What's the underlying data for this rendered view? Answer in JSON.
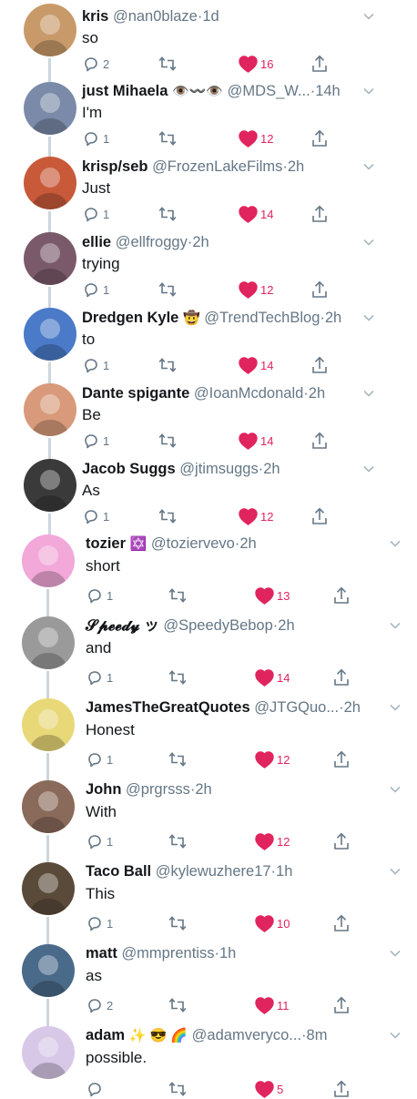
{
  "tweets": [
    {
      "name": "kris",
      "handle": "@nan0blaze",
      "sep": "·",
      "time": "1d",
      "text": "so",
      "replies": "2",
      "likes": "16",
      "avatar_color": "#c89a6a"
    },
    {
      "name": "just Mihaela",
      "badge": "👁️〰️👁️",
      "handle": "@MDS_W...",
      "sep": "·",
      "time": "14h",
      "text": "I'm",
      "replies": "1",
      "likes": "12",
      "avatar_color": "#7a8aa8"
    },
    {
      "name": "krisp/seb",
      "handle": "@FrozenLakeFilms",
      "sep": "·",
      "time": "2h",
      "text": "Just",
      "replies": "1",
      "likes": "14",
      "avatar_color": "#c85a3a"
    },
    {
      "name": "ellie",
      "handle": "@ellfroggy",
      "sep": "·",
      "time": "2h",
      "text": "trying",
      "replies": "1",
      "likes": "12",
      "avatar_color": "#7a5a6a"
    },
    {
      "name": "Dredgen Kyle",
      "badge": "🤠",
      "handle": "@TrendTechBlog",
      "sep": "·",
      "time": "2h",
      "text": "to",
      "replies": "1",
      "likes": "14",
      "avatar_color": "#4a7ac8"
    },
    {
      "name": "Dante spigante",
      "handle": "@IoanMcdonald",
      "sep": "·",
      "time": "2h",
      "text": "Be",
      "replies": "1",
      "likes": "14",
      "avatar_color": "#d89a7a"
    },
    {
      "name": "Jacob Suggs",
      "handle": "@jtimsuggs",
      "sep": "·",
      "time": "2h",
      "text": "As",
      "replies": "1",
      "likes": "12",
      "avatar_color": "#3a3a3a"
    },
    {
      "name": "tozier",
      "badge": "✡️",
      "handle": "@toziervevo",
      "sep": "·",
      "time": "2h",
      "text": "short",
      "replies": "1",
      "likes": "13",
      "avatar_color": "#f2a8d8"
    },
    {
      "name": "𝓢𝓹𝓮𝓮𝓭𝔂 ッ",
      "handle": "@SpeedyBebop",
      "sep": "·",
      "time": "2h",
      "text": "and",
      "replies": "1",
      "likes": "14",
      "avatar_color": "#9a9a9a"
    },
    {
      "name": "JamesTheGreatQuotes",
      "handle": "@JTGQuo...",
      "sep": "·",
      "time": "2h",
      "text": "Honest",
      "replies": "1",
      "likes": "12",
      "avatar_color": "#e8d878"
    },
    {
      "name": "John",
      "handle": "@prgrsss",
      "sep": "·",
      "time": "2h",
      "text": "With",
      "replies": "1",
      "likes": "12",
      "avatar_color": "#8a6a5a"
    },
    {
      "name": "Taco Ball",
      "handle": "@kylewuzhere17",
      "sep": "·",
      "time": "1h",
      "text": "This",
      "replies": "1",
      "likes": "10",
      "avatar_color": "#5a4a3a"
    },
    {
      "name": "matt",
      "handle": "@mmprentiss",
      "sep": "·",
      "time": "1h",
      "text": "as",
      "replies": "2",
      "likes": "11",
      "avatar_color": "#4a6a8a"
    },
    {
      "name": "adam",
      "badge": "✨ 😎        🌈",
      "handle": "@adamveryco...",
      "sep": "·",
      "time": "8m",
      "text": "possible.",
      "replies": "",
      "likes": "5",
      "avatar_color": "#d8c8e8"
    }
  ],
  "colors": {
    "like": "#e0245e",
    "muted": "#657786",
    "thread": "#ccd6dd"
  },
  "icons": {
    "reply": "reply-icon",
    "retweet": "retweet-icon",
    "like": "heart-icon",
    "share": "share-icon",
    "caret": "chevron-down-icon"
  }
}
